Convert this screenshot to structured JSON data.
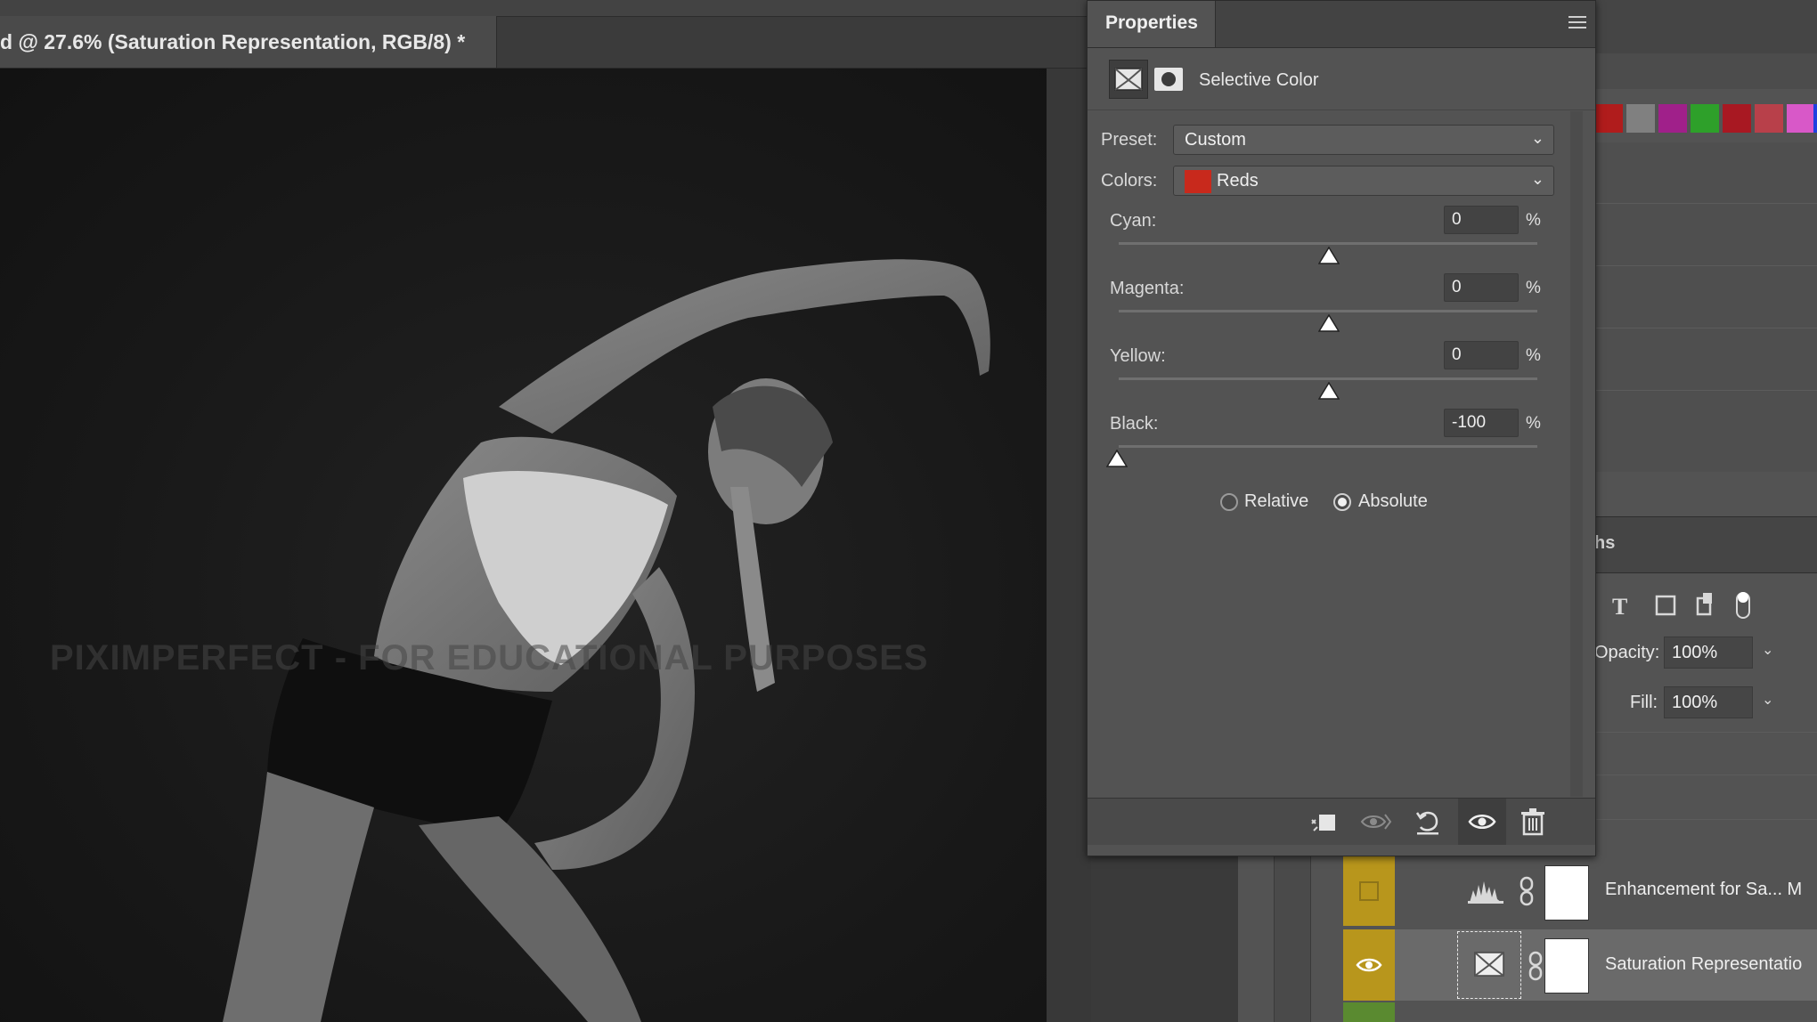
{
  "document": {
    "tab_title": "d @ 27.6% (Saturation Representation, RGB/8) *",
    "watermark": "PIXIMPERFECT - FOR EDUCATIONAL PURPOSES"
  },
  "properties": {
    "tab_label": "Properties",
    "adjustment_name": "Selective Color",
    "preset_label": "Preset:",
    "preset_value": "Custom",
    "colors_label": "Colors:",
    "colors_value": "Reds",
    "colors_swatch": "#c8291c",
    "sliders": [
      {
        "label": "Cyan:",
        "value": "0",
        "unit": "%"
      },
      {
        "label": "Magenta:",
        "value": "0",
        "unit": "%"
      },
      {
        "label": "Yellow:",
        "value": "0",
        "unit": "%"
      },
      {
        "label": "Black:",
        "value": "-100",
        "unit": "%"
      }
    ],
    "method_options": [
      "Relative",
      "Absolute"
    ],
    "method_selected": "Absolute"
  },
  "layers_panel": {
    "tab_partial": "hs",
    "opacity_label": "Opacity:",
    "opacity_value": "100%",
    "fill_label": "Fill:",
    "fill_value": "100%",
    "layers": [
      {
        "name": "Enhancement for Sa... M",
        "visible": false
      },
      {
        "name": "Saturation Representatio",
        "visible": true
      }
    ]
  },
  "swatches": [
    "#b01c1c",
    "#808080",
    "#a0208a",
    "#2ea02a",
    "#a81822",
    "#b8404a",
    "#d858c8",
    "#2040e0"
  ],
  "colors": {
    "accent_layer": "#b8961c"
  }
}
